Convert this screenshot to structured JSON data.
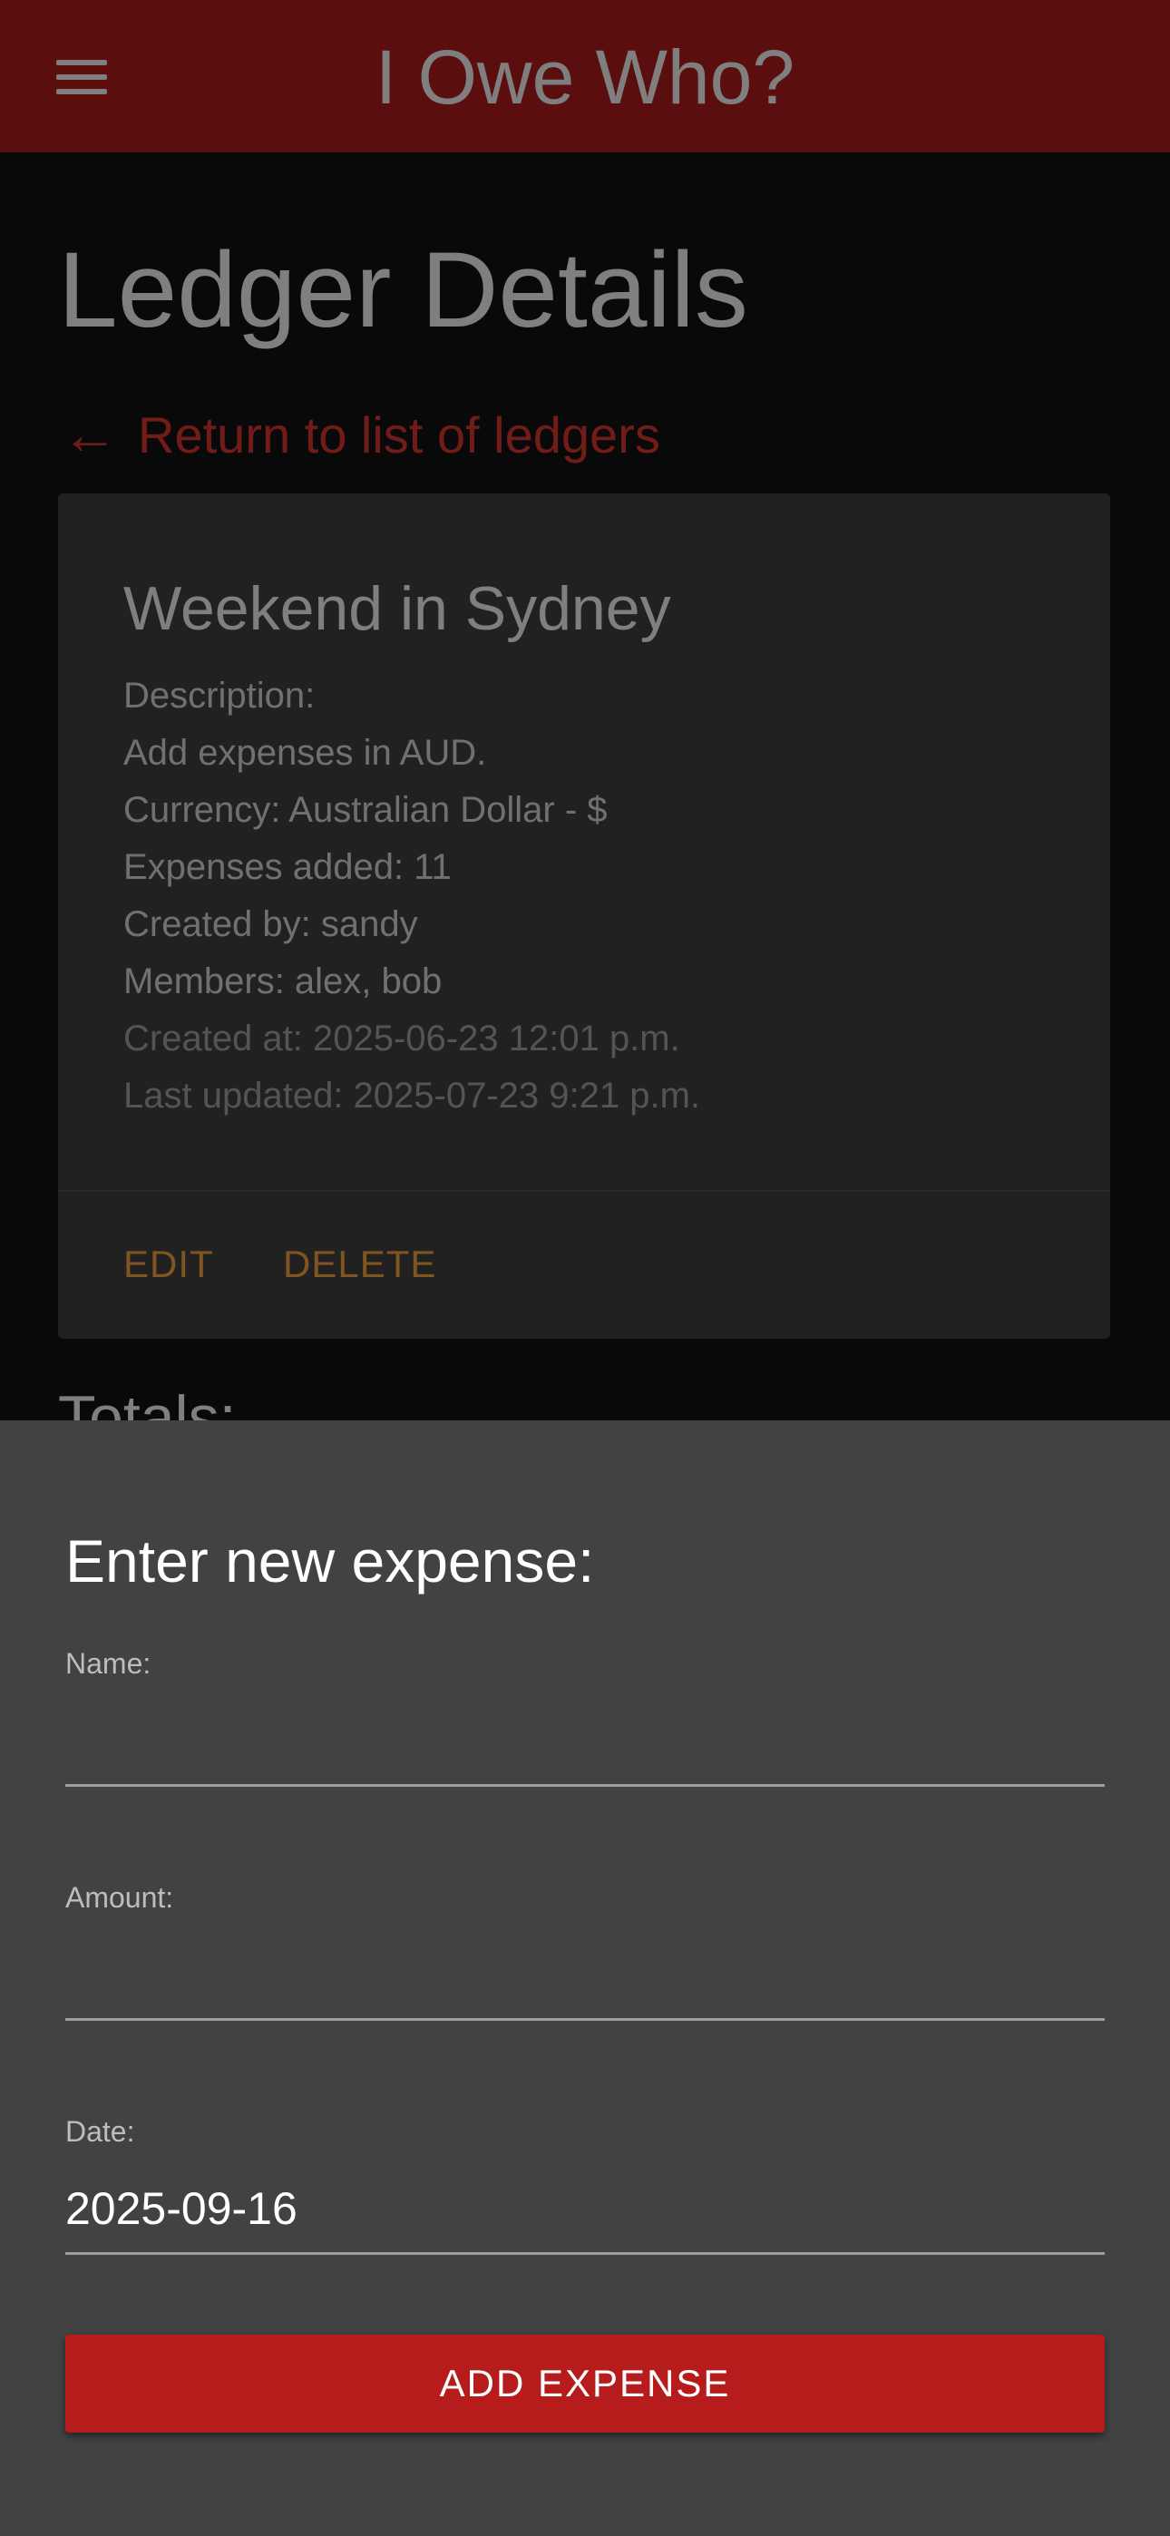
{
  "app_bar": {
    "title": "I Owe Who?",
    "menu_icon": "hamburger-menu-icon"
  },
  "page": {
    "title": "Ledger Details",
    "back_link": {
      "arrow": "←",
      "label": "Return to list of ledgers"
    },
    "totals_heading": "Totals:"
  },
  "ledger_card": {
    "title": "Weekend in Sydney",
    "description_label": "Description:",
    "description": "Add expenses in AUD.",
    "currency": "Currency: Australian Dollar - $",
    "expenses_added": "Expenses added: 11",
    "created_by": "Created by: sandy",
    "members": "Members: alex, bob",
    "created_at": "Created at: 2025-06-23 12:01 p.m.",
    "last_updated": "Last updated: 2025-07-23 9:21 p.m.",
    "edit_label": "EDIT",
    "delete_label": "DELETE"
  },
  "expense_form": {
    "title": "Enter new expense:",
    "name_label": "Name:",
    "name_value": "",
    "amount_label": "Amount:",
    "amount_value": "",
    "date_label": "Date:",
    "date_value": "2025-09-16",
    "submit_label": "ADD EXPENSE"
  },
  "colors": {
    "primary": "#b71c1c",
    "link": "#e53935",
    "card_action": "#ffab40",
    "sheet_background": "#424242"
  }
}
